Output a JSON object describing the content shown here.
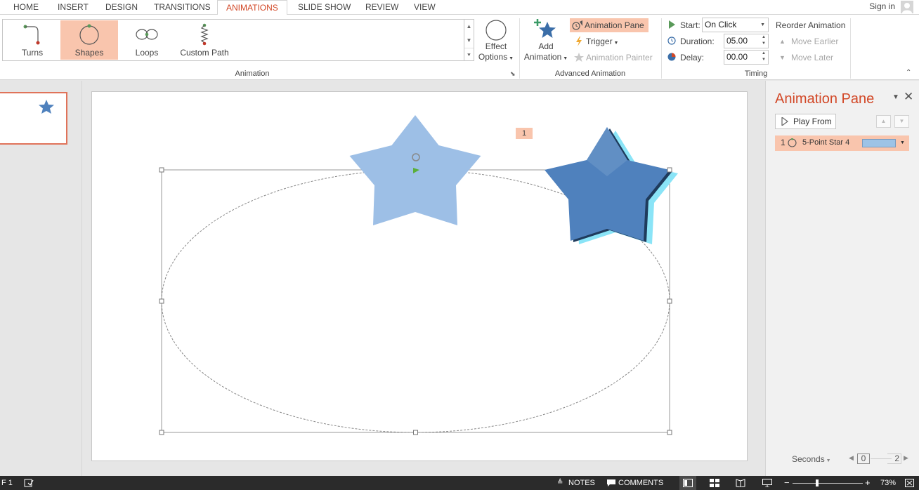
{
  "tabs": [
    {
      "label": "HOME",
      "active": false
    },
    {
      "label": "INSERT",
      "active": false
    },
    {
      "label": "DESIGN",
      "active": false
    },
    {
      "label": "TRANSITIONS",
      "active": false
    },
    {
      "label": "ANIMATIONS",
      "active": true
    },
    {
      "label": "SLIDE SHOW",
      "active": false
    },
    {
      "label": "REVIEW",
      "active": false
    },
    {
      "label": "VIEW",
      "active": false
    }
  ],
  "account": {
    "signin_label": "Sign in"
  },
  "ribbon": {
    "animation_group": {
      "label": "Animation",
      "gallery": [
        {
          "label": "Turns",
          "icon": "turns-path-icon",
          "selected": false
        },
        {
          "label": "Shapes",
          "icon": "shapes-path-icon",
          "selected": true
        },
        {
          "label": "Loops",
          "icon": "loops-path-icon",
          "selected": false
        },
        {
          "label": "Custom Path",
          "icon": "custom-path-icon",
          "selected": false
        }
      ],
      "effect_options": {
        "line1": "Effect",
        "line2": "Options"
      }
    },
    "advanced_group": {
      "label": "Advanced Animation",
      "add_animation": {
        "line1": "Add",
        "line2": "Animation"
      },
      "animation_pane_label": "Animation Pane",
      "trigger_label": "Trigger",
      "animation_painter_label": "Animation Painter"
    },
    "timing_group": {
      "label": "Timing",
      "start_label": "Start:",
      "start_value": "On Click",
      "duration_label": "Duration:",
      "duration_value": "05.00",
      "delay_label": "Delay:",
      "delay_value": "00.00",
      "reorder_label": "Reorder Animation",
      "move_earlier_label": "Move Earlier",
      "move_later_label": "Move Later"
    }
  },
  "slide": {
    "animation_badge": "1",
    "star_color": "#4f81bd",
    "ghost_star_color": "#9dbfe6"
  },
  "animation_pane": {
    "title": "Animation Pane",
    "play_from_label": "Play From",
    "items": [
      {
        "number": "1",
        "name": "5-Point Star 4"
      }
    ],
    "timeline": {
      "unit_label": "Seconds",
      "tick_start": "0",
      "tick_end": "2"
    }
  },
  "status_bar": {
    "slide_indicator": "F 1",
    "notes_label": "NOTES",
    "comments_label": "COMMENTS",
    "zoom_value": "73%"
  },
  "colors": {
    "accent": "#d24726",
    "highlight": "#f9c5ad",
    "status_bar": "#2b2b2b"
  }
}
